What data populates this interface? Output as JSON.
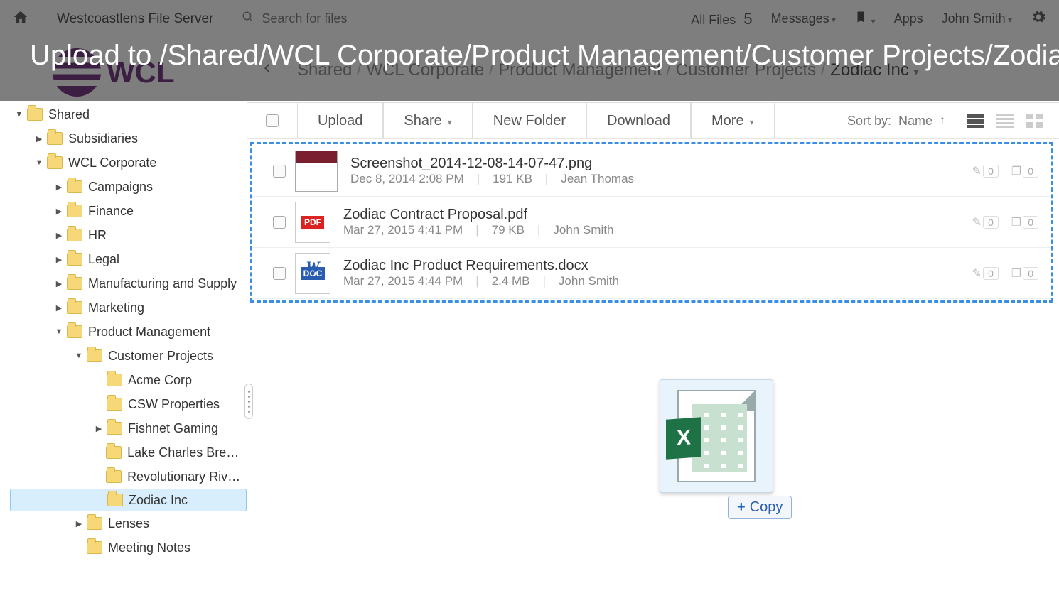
{
  "topbar": {
    "app_title": "Westcoastlens File Server",
    "search_placeholder": "Search for files",
    "all_files_label": "All Files",
    "all_files_count": "5",
    "messages_label": "Messages",
    "apps_label": "Apps",
    "user_name": "John Smith"
  },
  "banner": "Upload to /Shared/WCL Corporate/Product Management/Customer Projects/Zodiac Inc",
  "logo_text": "WCL",
  "breadcrumb": {
    "items": [
      "Shared",
      "WCL Corporate",
      "Product Management",
      "Customer Projects"
    ],
    "current": "Zodiac Inc"
  },
  "toolbar": {
    "upload": "Upload",
    "share": "Share",
    "new_folder": "New Folder",
    "download": "Download",
    "more": "More",
    "sort_by_label": "Sort by:",
    "sort_field": "Name"
  },
  "tree": [
    {
      "lvl": 1,
      "arrow": "open",
      "label": "Shared"
    },
    {
      "lvl": 2,
      "arrow": "closed",
      "label": "Subsidiaries"
    },
    {
      "lvl": 2,
      "arrow": "open",
      "label": "WCL Corporate"
    },
    {
      "lvl": 3,
      "arrow": "closed",
      "label": "Campaigns"
    },
    {
      "lvl": 3,
      "arrow": "closed",
      "label": "Finance"
    },
    {
      "lvl": 3,
      "arrow": "closed",
      "label": "HR"
    },
    {
      "lvl": 3,
      "arrow": "closed",
      "label": "Legal"
    },
    {
      "lvl": 3,
      "arrow": "closed",
      "label": "Manufacturing and Supply"
    },
    {
      "lvl": 3,
      "arrow": "closed",
      "label": "Marketing"
    },
    {
      "lvl": 3,
      "arrow": "open",
      "label": "Product Management"
    },
    {
      "lvl": 4,
      "arrow": "open",
      "label": "Customer Projects"
    },
    {
      "lvl": 5,
      "arrow": "none",
      "label": "Acme Corp"
    },
    {
      "lvl": 5,
      "arrow": "none",
      "label": "CSW Properties"
    },
    {
      "lvl": 5,
      "arrow": "closed",
      "label": "Fishnet Gaming"
    },
    {
      "lvl": 5,
      "arrow": "none",
      "label": "Lake Charles Brewing"
    },
    {
      "lvl": 5,
      "arrow": "none",
      "label": "Revolutionary Riverbo"
    },
    {
      "lvl": 5,
      "arrow": "none",
      "label": "Zodiac Inc",
      "selected": true
    },
    {
      "lvl": 4,
      "arrow": "closed",
      "label": "Lenses"
    },
    {
      "lvl": 4,
      "arrow": "none",
      "label": "Meeting Notes"
    }
  ],
  "files": [
    {
      "name": "Screenshot_2014-12-08-14-07-47.png",
      "date": "Dec 8, 2014 2:08 PM",
      "size": "191 KB",
      "owner": "Jean Thomas",
      "thumb": "img",
      "c1": "0",
      "c2": "0"
    },
    {
      "name": "Zodiac Contract Proposal.pdf",
      "date": "Mar 27, 2015 4:41 PM",
      "size": "79 KB",
      "owner": "John Smith",
      "thumb": "pdf",
      "badge": "PDF",
      "c1": "0",
      "c2": "0"
    },
    {
      "name": "Zodiac Inc Product Requirements.docx",
      "date": "Mar 27, 2015 4:44 PM",
      "size": "2.4 MB",
      "owner": "John Smith",
      "thumb": "doc",
      "badge": "DOC",
      "c1": "0",
      "c2": "0"
    }
  ],
  "drag_tooltip": "Copy"
}
